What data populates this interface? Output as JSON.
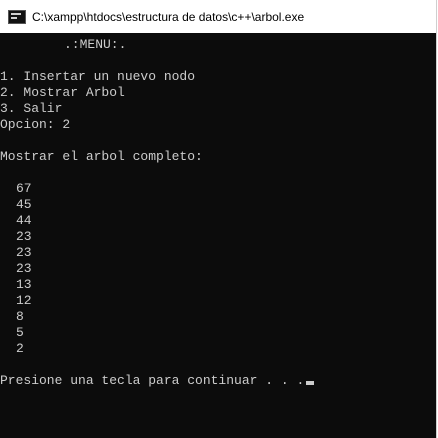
{
  "window": {
    "title": "C:\\xampp\\htdocs\\estructura de datos\\c++\\arbol.exe",
    "icon": "console-app-icon"
  },
  "console": {
    "menu_header": ".:MENU:.",
    "options": [
      "1. Insertar un nuevo nodo",
      "2. Mostrar Arbol",
      "3. Salir"
    ],
    "prompt": "Opcion: 2",
    "section_title": "Mostrar el arbol completo:",
    "tree_values": [
      "67",
      "45",
      "44",
      "23",
      "23",
      "23",
      "13",
      "12",
      "8",
      "5",
      "2"
    ],
    "continue_prompt": "Presione una tecla para continuar . . .",
    "colors": {
      "background": "#0c0c0c",
      "text": "#cccccc"
    }
  }
}
